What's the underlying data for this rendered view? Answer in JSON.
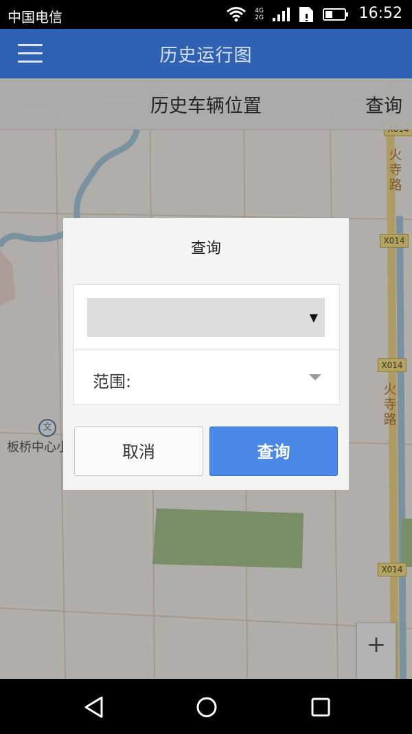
{
  "status_bar": {
    "carrier": "中国电信",
    "network_top": "4G",
    "network_bottom": "2G",
    "time": "16:52"
  },
  "app_bar": {
    "title": "历史运行图"
  },
  "sub_bar": {
    "title": "历史车辆位置",
    "query_label": "查询"
  },
  "map": {
    "road_badges": [
      "X014",
      "X014",
      "X014",
      "X014"
    ],
    "road_name_upper": [
      "火",
      "寺",
      "路"
    ],
    "road_name_lower": [
      "火",
      "寺",
      "路"
    ],
    "place_icon": "文",
    "place_label": "板桥中心小",
    "zoom_in_label": "+"
  },
  "dialog": {
    "title": "查询",
    "select_value": "",
    "select_caret": "▼",
    "range_label": "范围:",
    "cancel_label": "取消",
    "confirm_label": "查询"
  },
  "colors": {
    "app_bar": "#2f62b2",
    "primary_button": "#4a88e8"
  }
}
